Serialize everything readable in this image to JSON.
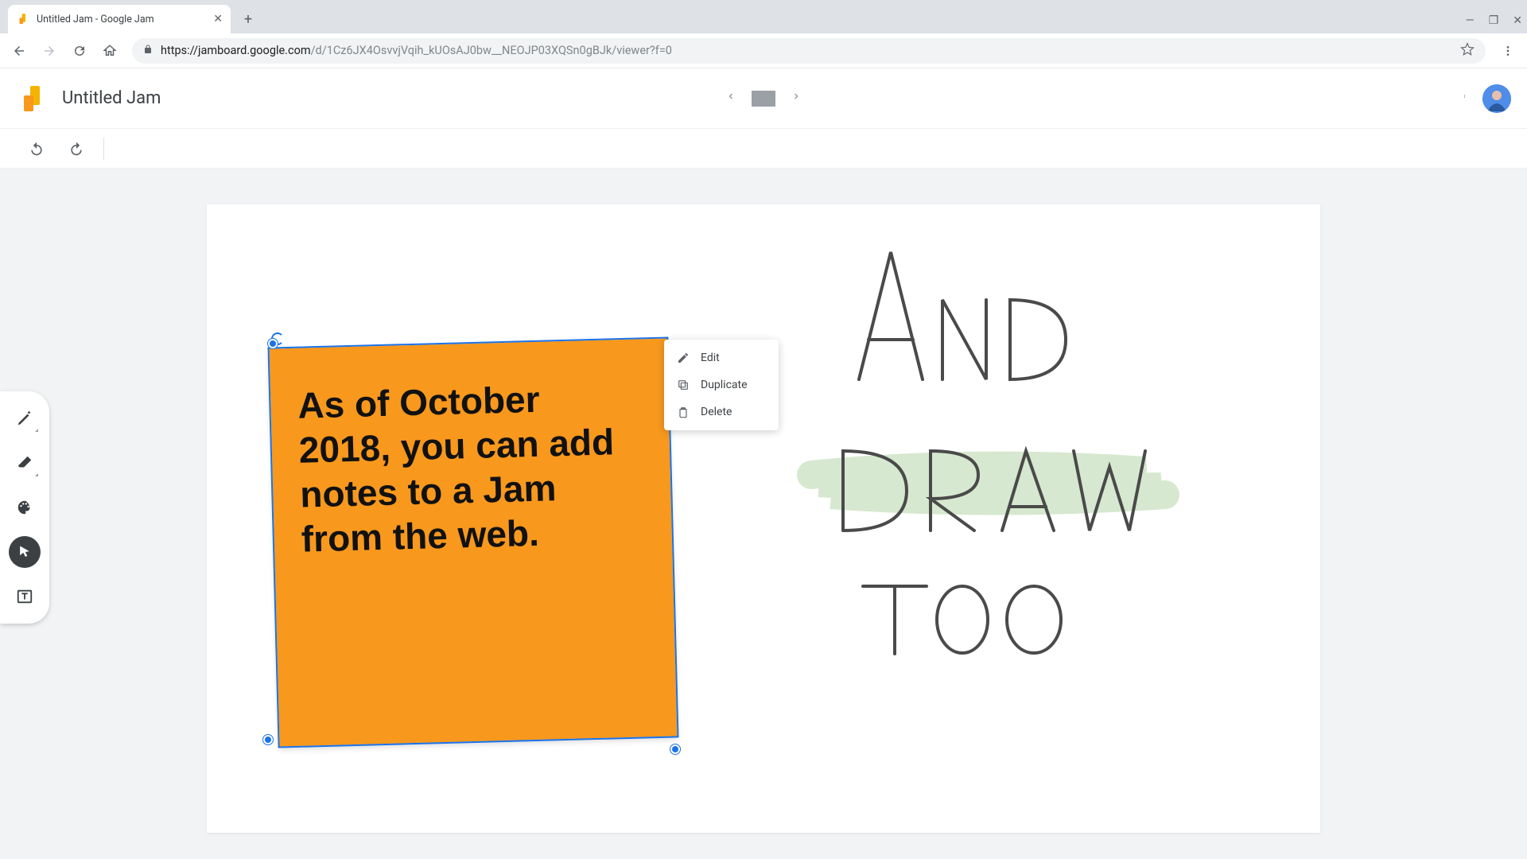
{
  "browser": {
    "tab_title": "Untitled Jam - Google Jam",
    "url_host": "https://jamboard.google.com",
    "url_path": "/d/1Cz6JX4OsvvjVqih_kUOsAJ0bw__NEOJP03XQSn0gBJk/viewer?f=0"
  },
  "app": {
    "doc_title": "Untitled Jam"
  },
  "sticky": {
    "text": "As of October 2018, you can add notes to a Jam from the web.",
    "color": "#f8981d"
  },
  "context_menu": {
    "edit": "Edit",
    "duplicate": "Duplicate",
    "delete": "Delete"
  },
  "handwriting": {
    "line1": "AND",
    "line2": "DRAW",
    "line3": "TOO"
  },
  "tools": {
    "pen": "pen-tool",
    "eraser": "eraser-tool",
    "palette": "palette-tool",
    "select": "select-tool",
    "text": "text-box-tool"
  }
}
